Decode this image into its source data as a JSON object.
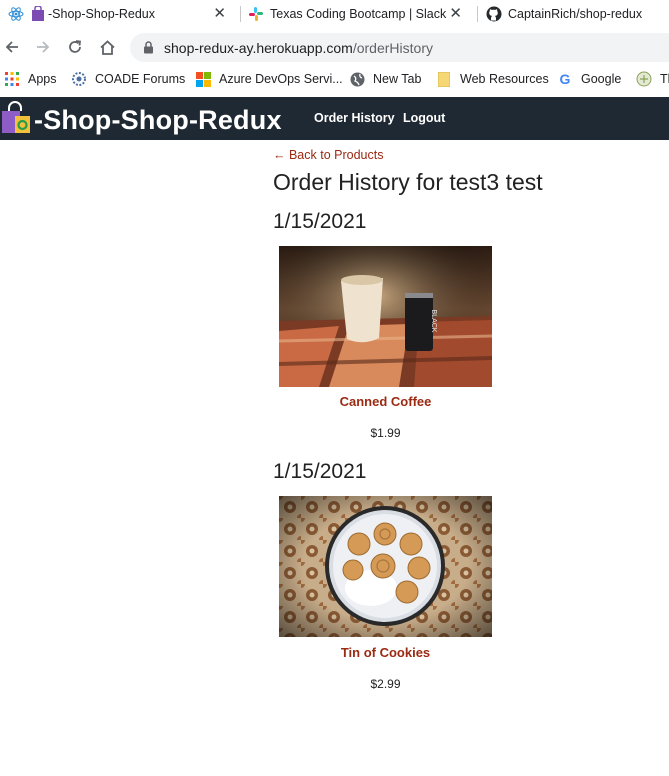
{
  "browser": {
    "tabs": [
      {
        "title": "-Shop-Shop-Redux",
        "favicon": "react-icon",
        "active": true
      },
      {
        "title": "Texas Coding Bootcamp | Slack",
        "favicon": "slack-icon"
      },
      {
        "title": "CaptainRich/shop-redux",
        "favicon": "github-icon"
      }
    ],
    "url_host": "shop-redux-ay.herokuapp.com",
    "url_path": "/orderHistory",
    "bookmarks": [
      {
        "label": "Apps",
        "icon": "apps-grid-icon"
      },
      {
        "label": "COADE Forums",
        "icon": "coade-icon"
      },
      {
        "label": "Azure DevOps Servi...",
        "icon": "microsoft-icon"
      },
      {
        "label": "New Tab",
        "icon": "globe-icon"
      },
      {
        "label": "Web Resources",
        "icon": "folder-icon"
      },
      {
        "label": "Google",
        "icon": "google-icon"
      },
      {
        "label": "Th",
        "icon": "site-icon"
      }
    ]
  },
  "header": {
    "brand": "-Shop-Shop-Redux",
    "nav": {
      "order_history": "Order History",
      "logout": "Logout"
    }
  },
  "main": {
    "back_link": "← Back to Products",
    "title": "Order History for test3 test",
    "orders": [
      {
        "date": "1/15/2021",
        "product": {
          "name": "Canned Coffee",
          "price": "$1.99",
          "image": "canned-coffee-photo"
        }
      },
      {
        "date": "1/15/2021",
        "product": {
          "name": "Tin of Cookies",
          "price": "$2.99",
          "image": "tin-of-cookies-photo"
        }
      }
    ]
  },
  "colors": {
    "header_bg": "#1f2933",
    "link": "#9a2a12",
    "omnibox_bg": "#f1f3f4"
  }
}
